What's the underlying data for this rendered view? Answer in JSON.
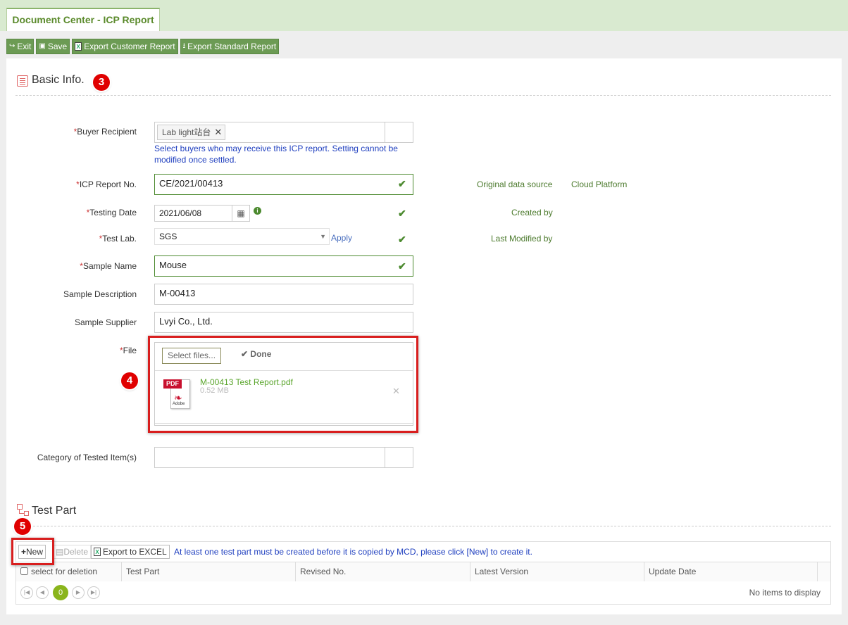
{
  "tab": {
    "title": "Document Center - ICP Report"
  },
  "toolbar": {
    "exit": "Exit",
    "save": "Save",
    "export_customer": "Export Customer Report",
    "export_standard": "Export Standard Report"
  },
  "basic_info": {
    "title": "Basic Info.",
    "badge": "3"
  },
  "form": {
    "buyer_recipient": {
      "label": "Buyer Recipient",
      "chip": "Lab light站台",
      "hint": "Select buyers who may receive this ICP report. Setting cannot be modified once settled."
    },
    "icp_report_no": {
      "label": "ICP Report No.",
      "value": "CE/2021/00413"
    },
    "testing_date": {
      "label": "Testing Date",
      "value": "2021/06/08"
    },
    "test_lab": {
      "label": "Test Lab.",
      "value": "SGS",
      "apply": "Apply"
    },
    "sample_name": {
      "label": "Sample Name",
      "value": "Mouse"
    },
    "sample_description": {
      "label": "Sample Description",
      "value": "M-00413"
    },
    "sample_supplier": {
      "label": "Sample Supplier",
      "value": "Lvyi Co., Ltd."
    },
    "file": {
      "label": "File",
      "select_btn": "Select files...",
      "done": "Done",
      "file_name": "M-00413 Test Report.pdf",
      "file_size": "0.52 MB",
      "pdf_label": "PDF",
      "adobe_label": "Adobe",
      "badge": "4"
    },
    "category": {
      "label": "Category of Tested Item(s)"
    }
  },
  "right_info": {
    "original_source_label": "Original data source",
    "original_source_value": "Cloud Platform",
    "created_by_label": "Created by",
    "last_modified_label": "Last Modified by"
  },
  "test_part": {
    "title": "Test Part",
    "badge": "5",
    "new_btn": "New",
    "delete_btn": "Delete",
    "export_btn": "Export to EXCEL",
    "notice": "At least one test part must be created before it is copied by MCD, please click [New] to create it.",
    "columns": [
      "select for deletion",
      "Test Part",
      "Revised No.",
      "Latest Version",
      "Update Date"
    ],
    "page": "0",
    "no_items": "No items to display"
  },
  "colors": {
    "accent": "#6c9b54",
    "required": "#cc3333",
    "hint": "#1f3fbf",
    "highlight": "#d81e1e"
  }
}
